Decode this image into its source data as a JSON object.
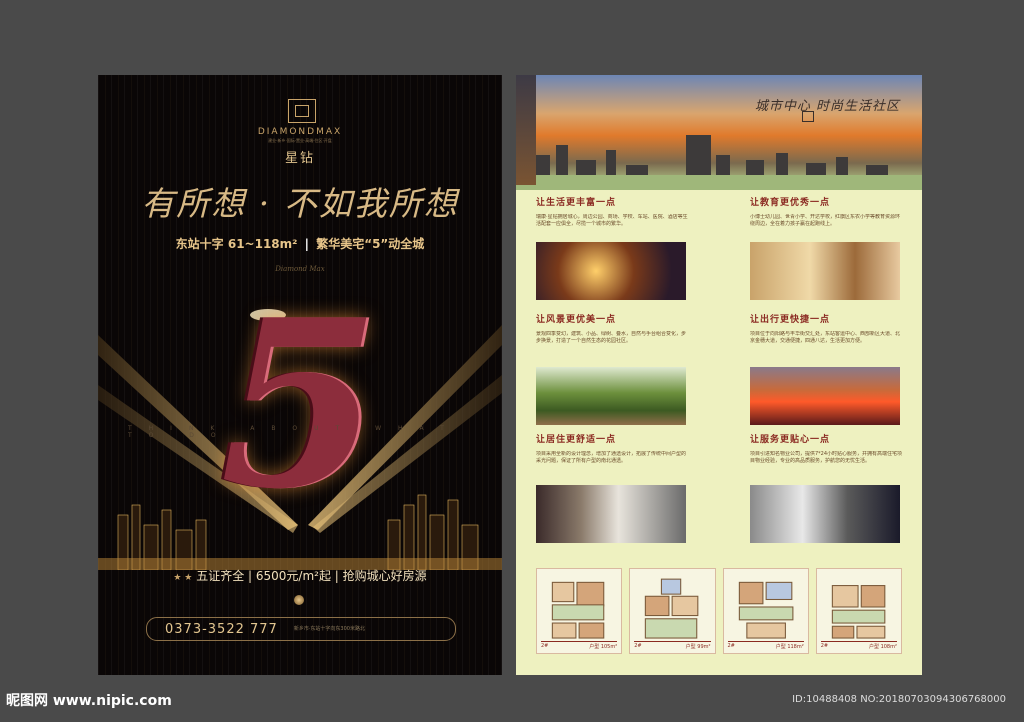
{
  "left_flyer": {
    "brand_en": "DIAMONDMAX",
    "brand_sub": "建业·新乡·国际·置业·高端·住区·开盘",
    "brand_cn": "星钻",
    "slogan": "有所想 · 不如我所想",
    "tagline_part1": "东站十字 61~118m²",
    "tagline_sep": "|",
    "tagline_part2": "繁华美宅“5”动全城",
    "script_text": "Diamond Max",
    "big_number": "5",
    "think_text": "THINK ABOUT WHAT TO DO",
    "features": "五证齐全 | 6500元/m²起 | 抢购城心好房源",
    "feature_star": "★ ★",
    "phone": "0373-3522 777",
    "address": "新乡市·东站十字向东300米路北"
  },
  "right_flyer": {
    "headline": "城市中心 时尚生活社区",
    "blocks": [
      {
        "title": "让生活更丰富一点",
        "desc": "瑞康·星钻拥居城心，周边公园、商场、学校、车站、医院、酒店等生活配套一应俱全，尽揽一个城市的繁华。"
      },
      {
        "title": "让教育更优秀一点",
        "desc": "小博士幼儿园、世青小学、开达学校，红旗区东农小学等教育资源环绕周边，全在着力孩子赢在起跑线上。"
      },
      {
        "title": "让风景更优美一点",
        "desc": "景观四季变幻，建筑、小品、绿树、叠水，自然与手台组合变化，步步换景，打造了一个自然生态的花园社区。"
      },
      {
        "title": "让出行更快捷一点",
        "desc": "项目位于向阳路与丰华街交汇处，东站客运中心、西部新区大道、北京金穗大道，交通便捷，四通八达，生活更加方便。"
      },
      {
        "title": "让居住更舒适一点",
        "desc": "项目采用全新的设计理念，增加了通透设计，拓展了传统中间户型的采光问题，保证了所有户型的南北通透。"
      },
      {
        "title": "让服务更贴心一点",
        "desc": "项目引进知名物业公司，提供7*24小时贴心服务，并拥有高端住宅项目物业经验，专业的高品质服务，护航您的无忧生活。"
      }
    ],
    "plans": [
      {
        "name": "2#",
        "area": "户型 105m²"
      },
      {
        "name": "2#",
        "area": "户型 99m²"
      },
      {
        "name": "2#",
        "area": "户型 118m²"
      },
      {
        "name": "2#",
        "area": "户型 108m²"
      }
    ]
  },
  "watermark": {
    "left": "昵图网 www.nipic.com",
    "right": "ID:10488408 NO:20180703094306768000"
  }
}
